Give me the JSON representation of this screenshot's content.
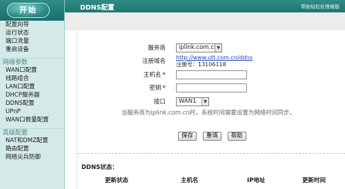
{
  "sidebar": {
    "logo_label": "开始",
    "groups": [
      {
        "heading": "",
        "items": [
          "配置向导",
          "运行状态",
          "端口流量",
          "重启设备"
        ]
      },
      {
        "heading": "网络参数",
        "items": [
          "WAN口配置",
          "线路组合",
          "LAN口配置",
          "DHCP服务器",
          "DDNS配置",
          "UPnP",
          "WAN口数量配置"
        ]
      },
      {
        "heading": "高级配置",
        "items": [
          "NAT和DMZ配置",
          "路由配置",
          "网络尖兵防御"
        ]
      }
    ]
  },
  "header": {
    "title": "DDNS配置",
    "tip": "帮助轻松处理难题"
  },
  "form": {
    "service_provider": {
      "label": "服务商",
      "value": "iplink.com.cn"
    },
    "register_domain": {
      "label": "注册域名",
      "link": "http://www.utt.com.cn/ddns",
      "register_id_label": "注册号：13106118"
    },
    "hostname": {
      "label": "主机名",
      "value": ""
    },
    "password": {
      "label": "密钥",
      "value": ""
    },
    "interface": {
      "label": "接口",
      "value": "WAN1"
    },
    "note": "当服务商为iplink.com.cn时，系统时间需要设置为网络时间同步。"
  },
  "buttons": {
    "save": "保存",
    "reset": "重填",
    "help": "帮助"
  },
  "status": {
    "title": "DDNS状态：",
    "columns": [
      "更新状态",
      "主机名",
      "IP地址",
      "更新时间"
    ]
  },
  "colors": {
    "accent": "#1f7671",
    "sidebar_bg": "#d4eae9",
    "required": "#d02020",
    "link": "#1a3fb6"
  }
}
